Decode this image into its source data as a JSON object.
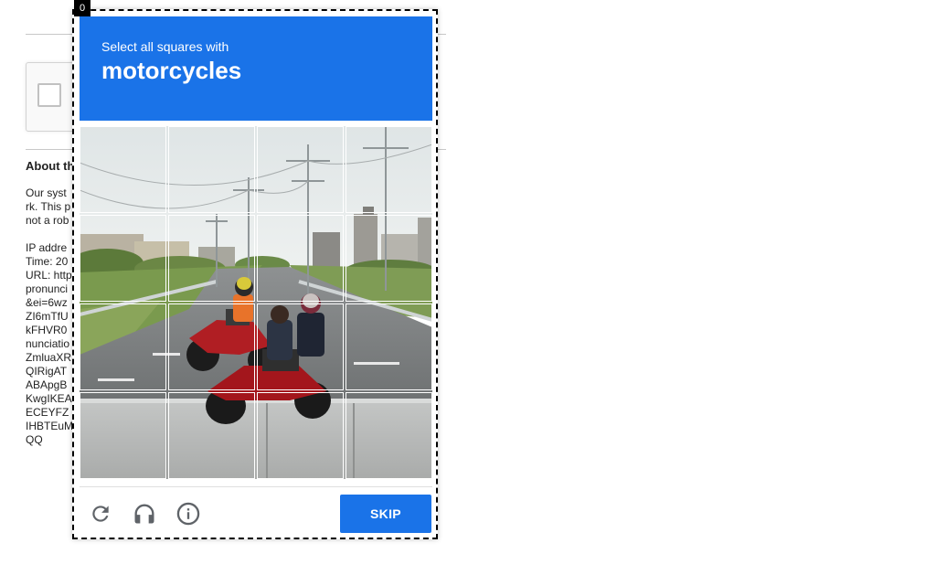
{
  "background_page": {
    "heading": "About th",
    "lines": [
      "Our syst",
      "rk. This p",
      "not a rob",
      "",
      "IP addre",
      "Time: 20",
      "URL: http",
      "pronunci",
      "&ei=6wz",
      "ZI6mTfU",
      "kFHVR0",
      "nunciatio",
      "ZmluaXR",
      "QIRigAT",
      "ABApgB",
      "KwgIKEA",
      "ECEYFZ",
      "IHBTEuM",
      "QQ"
    ]
  },
  "challenge": {
    "counter": "0",
    "instruction": "Select all squares with",
    "target": "motorcycles",
    "skip_label": "SKIP",
    "accent_color": "#1a73e8",
    "grid_size": 4,
    "icons": {
      "reload": "reload-icon",
      "audio": "headphones-icon",
      "info": "info-icon"
    }
  }
}
